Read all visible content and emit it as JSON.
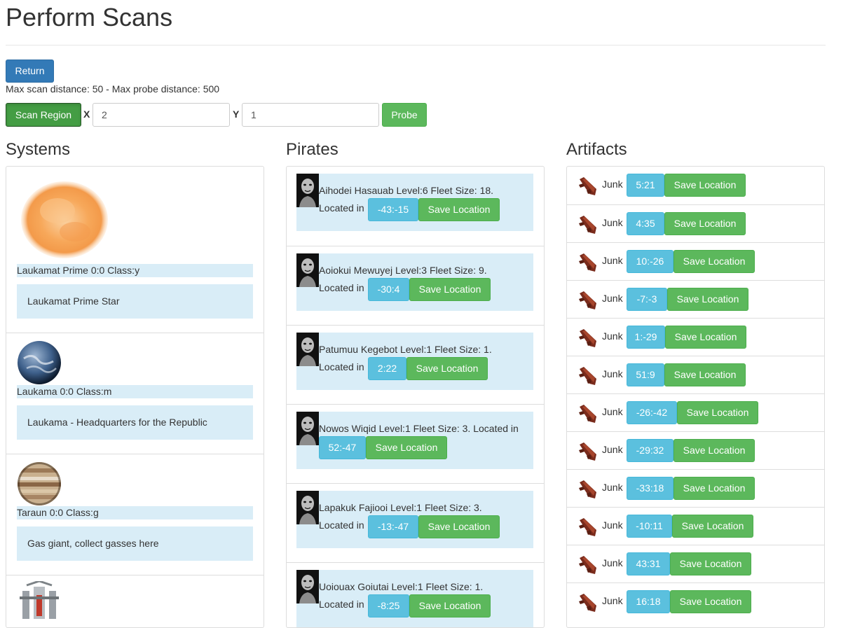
{
  "page": {
    "title": "Perform Scans",
    "return_label": "Return",
    "max_info": "Max scan distance: 50 - Max probe distance: 500",
    "scan_label": "Scan Region",
    "x_label": "X",
    "x_value": "2",
    "y_label": "Y",
    "y_value": "1",
    "probe_label": "Probe"
  },
  "columns": {
    "systems": "Systems",
    "pirates": "Pirates",
    "artifacts": "Artifacts"
  },
  "systems": [
    {
      "name": "Laukamat Prime 0:0 Class:y",
      "desc": "Laukamat Prime Star",
      "icon": "star-icon"
    },
    {
      "name": "Laukama 0:0 Class:m",
      "desc": "Laukama - Headquarters for the Republic",
      "icon": "earth-planet-icon"
    },
    {
      "name": "Taraun 0:0 Class:g",
      "desc": "Gas giant, collect gasses here",
      "icon": "gas-giant-icon"
    }
  ],
  "pirates": [
    {
      "text": "Aihodei Hasauab Level:6 Fleet Size: 18.",
      "located": "Located in",
      "coord": "-43:-15"
    },
    {
      "text": "Aoiokui Mewuyej Level:3 Fleet Size: 9.",
      "located": "Located in",
      "coord": "-30:4"
    },
    {
      "text": "Patumuu Kegebot Level:1 Fleet Size: 1.",
      "located": "Located in",
      "coord": "2:22"
    },
    {
      "text": "Nowos Wiqid Level:1 Fleet Size: 3. Located in",
      "located": "",
      "coord": "52:-47"
    },
    {
      "text": "Lapakuk Fajiooi Level:1 Fleet Size: 3.",
      "located": "Located in",
      "coord": "-13:-47"
    },
    {
      "text": "Uoiouax Goiutai Level:1 Fleet Size: 1.",
      "located": "Located in",
      "coord": "-8:25"
    }
  ],
  "save_label": "Save Location",
  "artifacts": [
    {
      "name": "Junk",
      "coord": "5:21"
    },
    {
      "name": "Junk",
      "coord": "4:35"
    },
    {
      "name": "Junk",
      "coord": "10:-26"
    },
    {
      "name": "Junk",
      "coord": "-7:-3"
    },
    {
      "name": "Junk",
      "coord": "1:-29"
    },
    {
      "name": "Junk",
      "coord": "51:9"
    },
    {
      "name": "Junk",
      "coord": "-26:-42"
    },
    {
      "name": "Junk",
      "coord": "-29:32"
    },
    {
      "name": "Junk",
      "coord": "-33:18"
    },
    {
      "name": "Junk",
      "coord": "-10:11"
    },
    {
      "name": "Junk",
      "coord": "43:31"
    },
    {
      "name": "Junk",
      "coord": "16:18"
    }
  ]
}
